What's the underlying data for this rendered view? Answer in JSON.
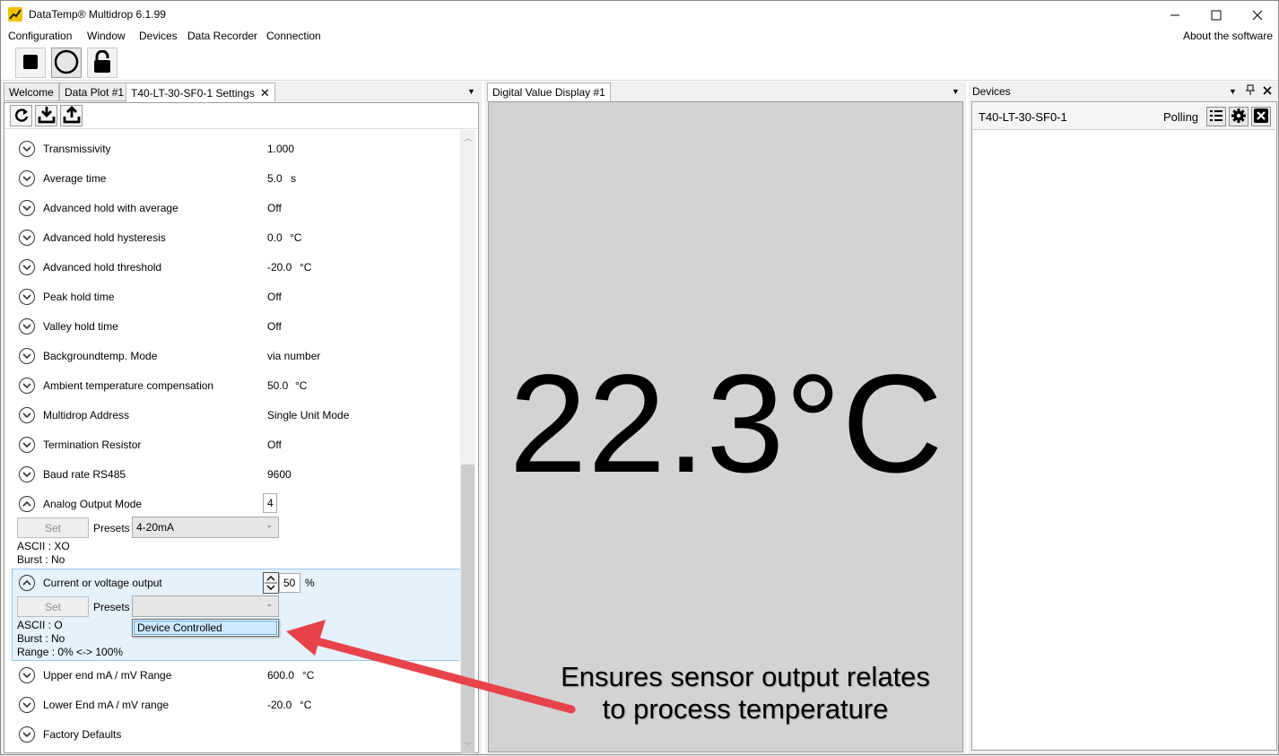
{
  "window": {
    "title": "DataTemp® Multidrop 6.1.99"
  },
  "menu": {
    "items": [
      "Configuration",
      "Window",
      "Devices",
      "Data Recorder",
      "Connection"
    ],
    "about": "About the software"
  },
  "left_panel": {
    "tabs": [
      {
        "label": "Welcome"
      },
      {
        "label": "Data Plot #1"
      },
      {
        "label": "T40-LT-30-SF0-1 Settings",
        "close": "✕"
      }
    ],
    "settings": [
      {
        "label": "Transmissivity",
        "value": "1.000",
        "unit": ""
      },
      {
        "label": "Average time",
        "value": "5.0",
        "unit": "s"
      },
      {
        "label": "Advanced hold with average",
        "value": "Off",
        "unit": ""
      },
      {
        "label": "Advanced hold hysteresis",
        "value": "0.0",
        "unit": "°C"
      },
      {
        "label": "Advanced hold threshold",
        "value": "-20.0",
        "unit": "°C"
      },
      {
        "label": "Peak hold time",
        "value": "Off",
        "unit": ""
      },
      {
        "label": "Valley hold time",
        "value": "Off",
        "unit": ""
      },
      {
        "label": "Backgroundtemp. Mode",
        "value": "via number",
        "unit": ""
      },
      {
        "label": "Ambient temperature compensation",
        "value": "50.0",
        "unit": "°C"
      },
      {
        "label": "Multidrop Address",
        "value": "Single Unit Mode",
        "unit": ""
      },
      {
        "label": "Termination Resistor",
        "value": "Off",
        "unit": ""
      },
      {
        "label": "Baud rate RS485",
        "value": "9600",
        "unit": ""
      }
    ],
    "analog_output": {
      "label": "Analog Output Mode",
      "value": "4",
      "set_label": "Set",
      "presets_label": "Presets",
      "preset_selected": "4-20mA",
      "ascii": "ASCII : XO",
      "burst": "Burst : No"
    },
    "current_output": {
      "label": "Current or voltage output",
      "value": "50",
      "unit": "%",
      "set_label": "Set",
      "presets_label": "Presets",
      "preset_selected": "",
      "dropdown_option": "Device Controlled",
      "ascii": "ASCII : O",
      "burst": "Burst : No",
      "range": "Range : 0% <-> 100%"
    },
    "settings_after": [
      {
        "label": "Upper end mA / mV Range",
        "value": "600.0",
        "unit": "°C"
      },
      {
        "label": "Lower End mA / mV range",
        "value": "-20.0",
        "unit": "°C"
      },
      {
        "label": "Factory Defaults",
        "value": "",
        "unit": ""
      }
    ]
  },
  "middle_panel": {
    "tab": "Digital Value Display #1",
    "display_value": "22.3°C"
  },
  "right_panel": {
    "title": "Devices",
    "device": {
      "name": "T40-LT-30-SF0-1",
      "status": "Polling"
    }
  },
  "annotation": {
    "line1": "Ensures sensor output relates",
    "line2": "to process temperature",
    "arrow_color": "#e8434a"
  },
  "colors": {
    "highlight_bg": "#e5f1fb",
    "display_bg": "#d3d3d3",
    "app_icon": "#f2c200"
  }
}
